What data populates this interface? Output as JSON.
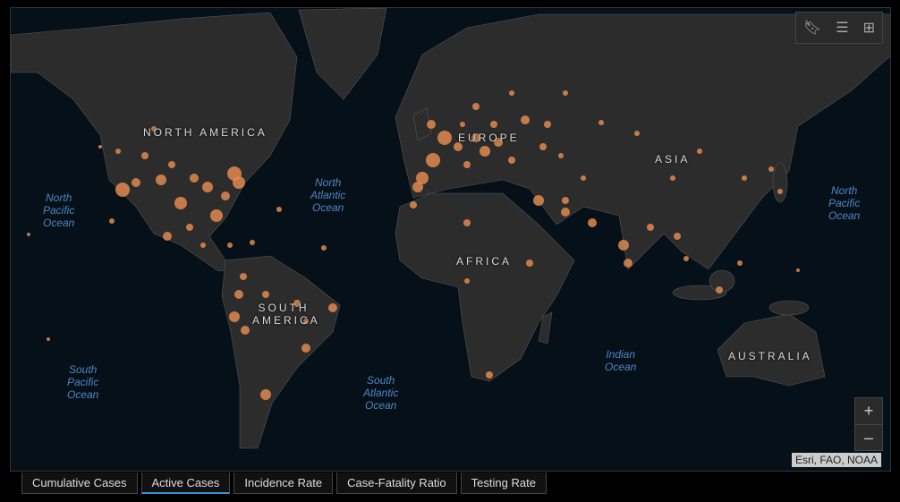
{
  "map": {
    "regions": [
      "NORTH AMERICA",
      "SOUTH AMERICA",
      "EUROPE",
      "AFRICA",
      "ASIA",
      "AUSTRALIA"
    ],
    "oceans": {
      "north_pacific": [
        "North",
        "Pacific",
        "Ocean"
      ],
      "north_atlantic": [
        "North",
        "Atlantic",
        "Ocean"
      ],
      "south_pacific": [
        "South",
        "Pacific",
        "Ocean"
      ],
      "south_atlantic": [
        "South",
        "Atlantic",
        "Ocean"
      ],
      "indian": [
        "Indian",
        "Ocean"
      ],
      "north_pacific_east": [
        "North",
        "Pacific",
        "Ocean"
      ]
    },
    "attribution": "Esri, FAO, NOAA",
    "zoom_in": "+",
    "zoom_out": "–",
    "colors": {
      "land": "#2c2c2c",
      "water": "#061019",
      "bubble": "#e08a4f"
    }
  },
  "tabs": [
    {
      "label": "Cumulative Cases",
      "active": false
    },
    {
      "label": "Active Cases",
      "active": true
    },
    {
      "label": "Incidence Rate",
      "active": false
    },
    {
      "label": "Case-Fatality Ratio",
      "active": false
    },
    {
      "label": "Testing Rate",
      "active": false
    }
  ]
}
